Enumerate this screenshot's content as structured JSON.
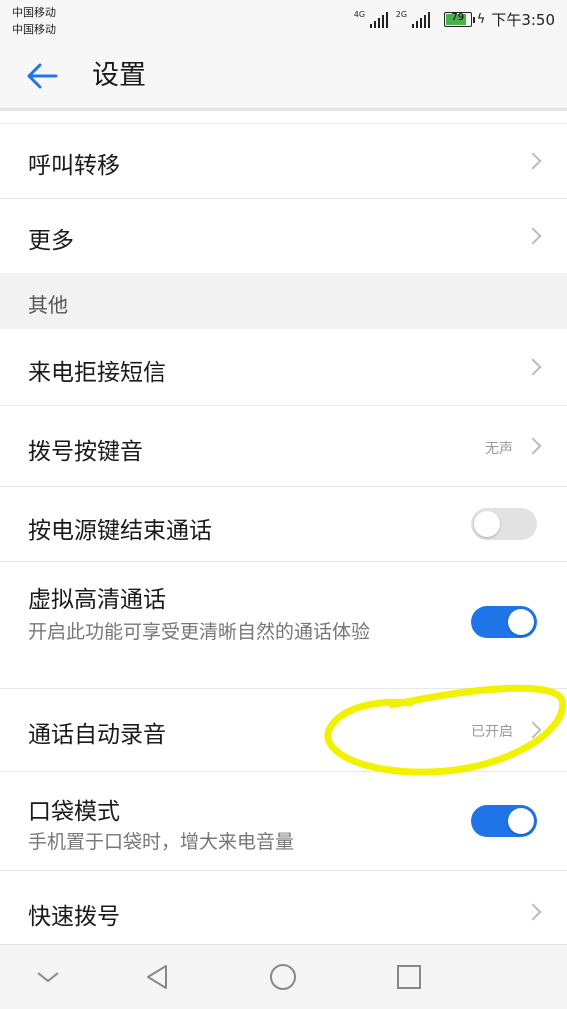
{
  "status_bar": {
    "carrier_1": "中国移动",
    "carrier_2": "中国移动",
    "network_1": "4G",
    "network_2": "2G",
    "battery_level": "79",
    "time": "下午3:50"
  },
  "header": {
    "title": "设置",
    "back_icon": "arrow-left-icon"
  },
  "rows_top": [
    {
      "label": "呼叫转移"
    },
    {
      "label": "更多"
    }
  ],
  "section_other": {
    "title": "其他",
    "rows": [
      {
        "label": "来电拒接短信"
      },
      {
        "label": "拨号按键音",
        "value": "无声"
      },
      {
        "label": "按电源键结束通话",
        "toggle": "off"
      },
      {
        "label": "虚拟高清通话",
        "subtitle": "开启此功能可享受更清晰自然的通话体验",
        "toggle": "on"
      },
      {
        "label": "通话自动录音",
        "value": "已开启"
      },
      {
        "label": "口袋模式",
        "subtitle": "手机置于口袋时，增大来电音量",
        "toggle": "on"
      },
      {
        "label": "快速拨号"
      }
    ]
  },
  "nav_bar": {
    "icons": [
      "chevron-down-icon",
      "back-triangle-icon",
      "home-circle-icon",
      "recents-square-icon"
    ]
  },
  "colors": {
    "accent": "#1f74e8",
    "highlight_marker": "#f2f200"
  }
}
